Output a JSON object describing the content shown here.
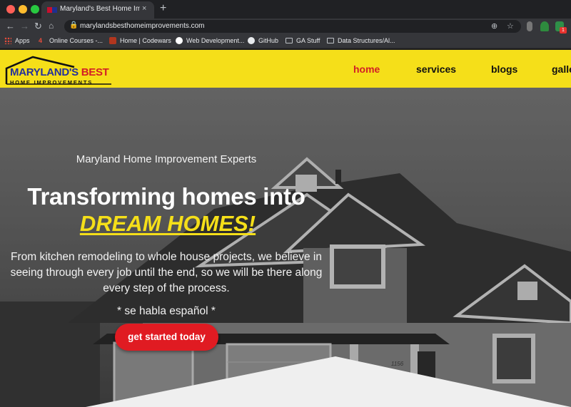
{
  "browser": {
    "tab_title": "Maryland's Best Home Improve",
    "close_glyph": "×",
    "newtab_glyph": "+",
    "url": "marylandsbesthomeimprovements.com",
    "bookmarks": [
      {
        "label": "Apps",
        "icon": "apps-grid-icon"
      },
      {
        "label": "Online Courses -...",
        "icon": "courses-icon"
      },
      {
        "label": "Home | Codewars",
        "icon": "codewars-icon"
      },
      {
        "label": "Web Development...",
        "icon": "web-dev-icon"
      },
      {
        "label": "GitHub",
        "icon": "github-icon"
      },
      {
        "label": "GA Stuff",
        "icon": "folder-icon"
      },
      {
        "label": "Data Structures/Al...",
        "icon": "folder-icon"
      }
    ],
    "extension_badge": "1"
  },
  "site": {
    "logo": {
      "line1_blue": "MARYLAND'S",
      "line1_red": " BEST",
      "line2": "HOME IMPROVEMENTS"
    },
    "nav": [
      {
        "label": "home",
        "active": true
      },
      {
        "label": "services",
        "active": false
      },
      {
        "label": "blogs",
        "active": false
      },
      {
        "label": "galle",
        "active": false
      }
    ],
    "colors": {
      "header_bg": "#f5df19",
      "accent_red": "#e01b22",
      "brand_blue": "#24309c"
    }
  },
  "hero": {
    "subtitle": "Maryland Home Improvement Experts",
    "title": "Transforming homes into",
    "highlight": "DREAM HOMES!",
    "body": "From kitchen remodeling to whole house projects, we believe in seeing through every job until the end, so we will be there along every step of the process.",
    "note": "* se habla español *",
    "cta_label": "get started today",
    "house_number": "1156"
  }
}
